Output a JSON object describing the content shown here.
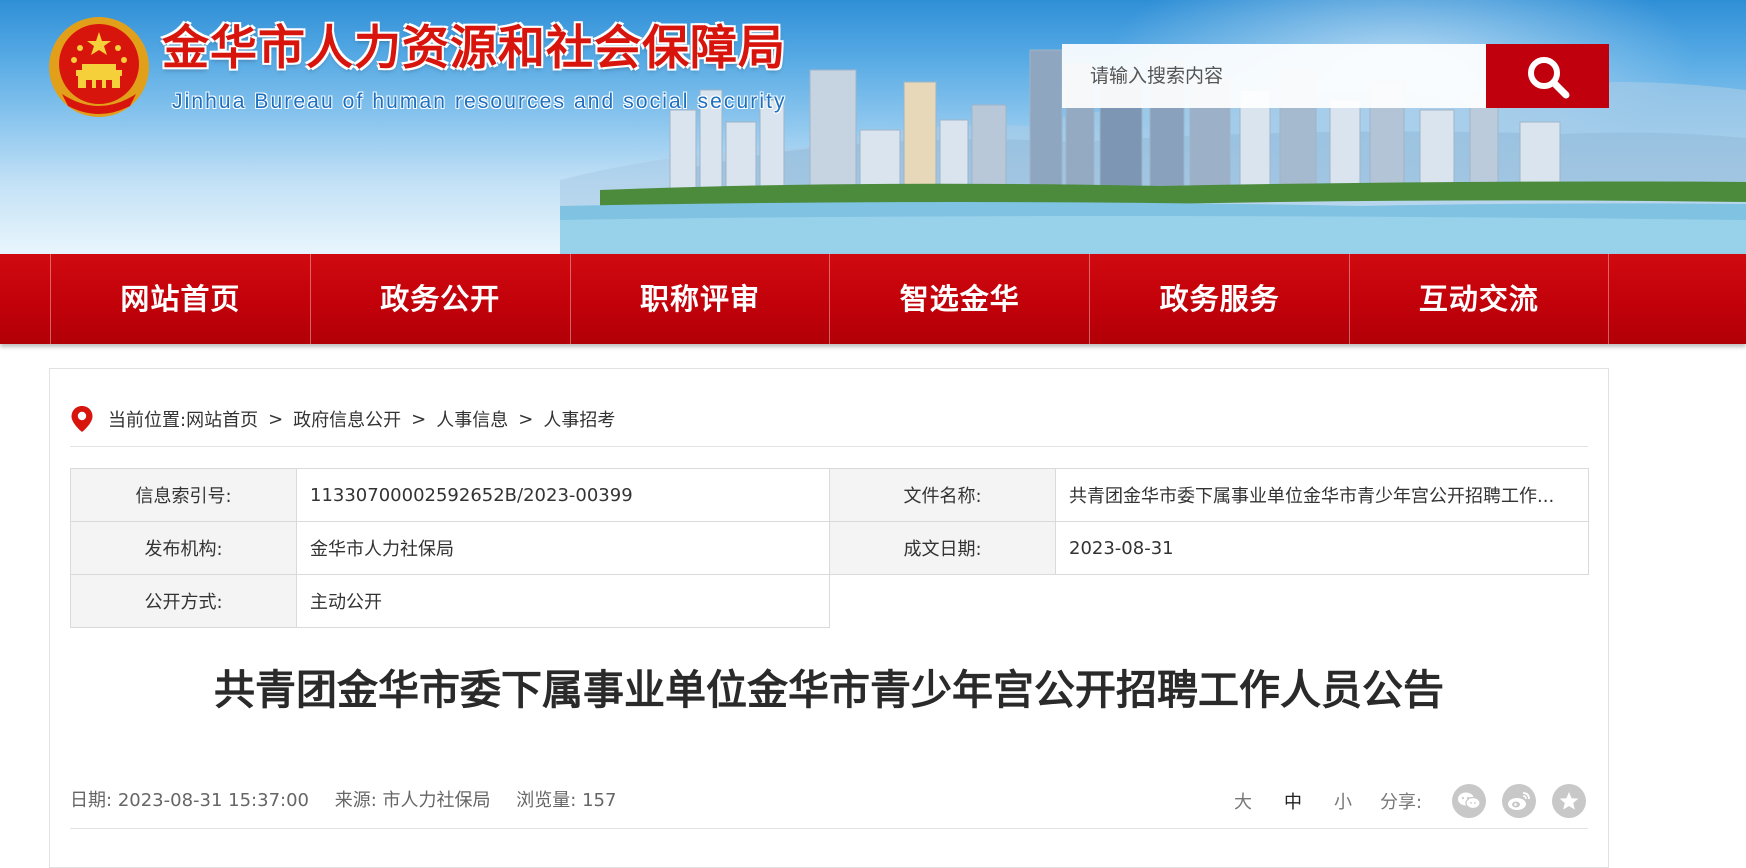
{
  "header": {
    "title_cn": "金华市人力资源和社会保障局",
    "title_en": "Jinhua Bureau of human resources and social security",
    "emblem_icon": "national-emblem-icon"
  },
  "search": {
    "placeholder": "请输入搜索内容",
    "button_icon": "search-icon"
  },
  "nav": {
    "items": [
      "网站首页",
      "政务公开",
      "职称评审",
      "智选金华",
      "政务服务",
      "互动交流"
    ]
  },
  "breadcrumb": {
    "prefix": "当前位置:",
    "items": [
      "网站首页",
      "政府信息公开",
      "人事信息",
      "人事招考"
    ],
    "separator": ">",
    "icon": "location-pin-icon"
  },
  "info": {
    "index_label": "信息索引号:",
    "index_value": "11330700002592652B/2023-00399",
    "filename_label": "文件名称:",
    "filename_value": "共青团金华市委下属事业单位金华市青少年宫公开招聘工作...",
    "publisher_label": "发布机构:",
    "publisher_value": "金华市人力社保局",
    "date_label": "成文日期:",
    "date_value": "2023-08-31",
    "method_label": "公开方式:",
    "method_value": "主动公开"
  },
  "article": {
    "title": "共青团金华市委下属事业单位金华市青少年宫公开招聘工作人员公告"
  },
  "meta": {
    "date_label": "日期:",
    "date_value": "2023-08-31 15:37:00",
    "source_label": "来源:",
    "source_value": "市人力社保局",
    "views_label": "浏览量:",
    "views_value": "157",
    "font_sizes": [
      "大",
      "中",
      "小"
    ],
    "active_font_size": "中",
    "share_label": "分享:",
    "share_icons": [
      "wechat-icon",
      "weibo-icon",
      "favorite-star-icon"
    ]
  },
  "colors": {
    "brand_red": "#c0000c",
    "banner_blue": "#55a9e4",
    "title_red": "#d8150c"
  }
}
